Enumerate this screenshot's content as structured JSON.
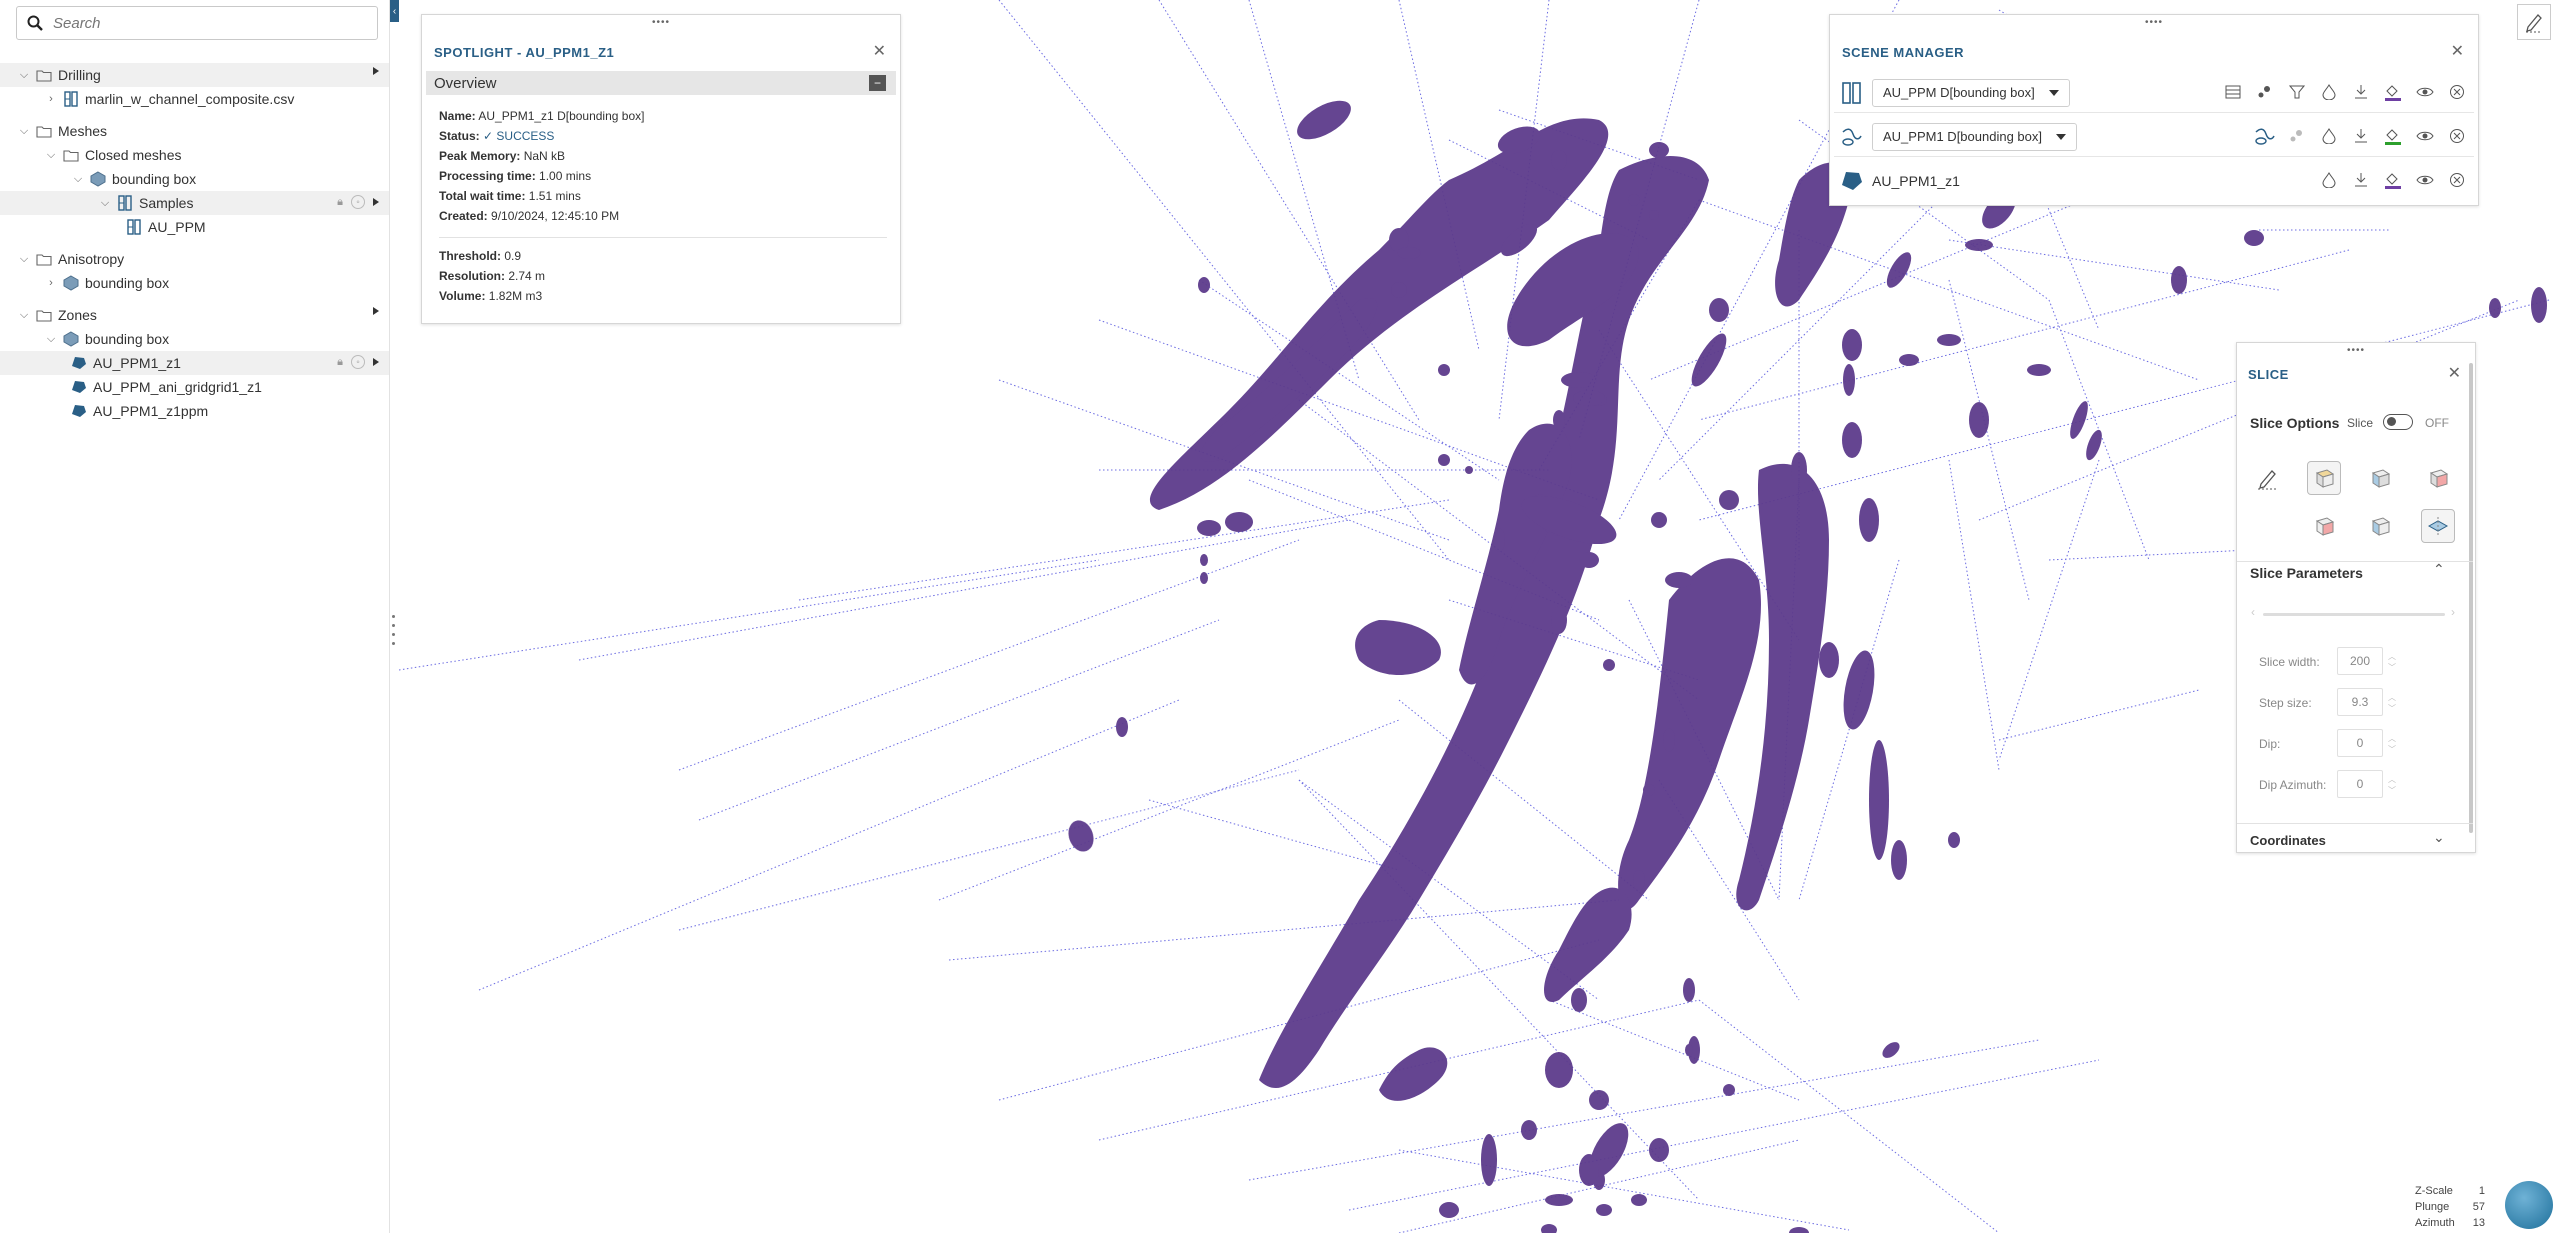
{
  "search": {
    "placeholder": "Search"
  },
  "tree": {
    "drilling": {
      "label": "Drilling",
      "children": [
        {
          "label": "marlin_w_channel_composite.csv"
        }
      ]
    },
    "meshes": {
      "label": "Meshes",
      "closed": "Closed meshes",
      "bbox": "bounding box",
      "samples": "Samples",
      "au_ppm": "AU_PPM"
    },
    "anisotropy": {
      "label": "Anisotropy",
      "bbox": "bounding box"
    },
    "zones": {
      "label": "Zones",
      "bbox": "bounding box",
      "items": [
        "AU_PPM1_z1",
        "AU_PPM_ani_gridgrid1_z1",
        "AU_PPM1_z1ppm"
      ]
    }
  },
  "spotlight": {
    "title": "SPOTLIGHT - AU_PPM1_Z1",
    "overview": "Overview",
    "fields": {
      "name_k": "Name:",
      "name_v": "AU_PPM1_z1 D[bounding box]",
      "status_k": "Status:",
      "status_v": "SUCCESS",
      "mem_k": "Peak Memory:",
      "mem_v": "NaN kB",
      "proc_k": "Processing time:",
      "proc_v": "1.00 mins",
      "wait_k": "Total wait time:",
      "wait_v": "1.51 mins",
      "created_k": "Created:",
      "created_v": "9/10/2024, 12:45:10 PM",
      "thr_k": "Threshold:",
      "thr_v": "0.9",
      "res_k": "Resolution:",
      "res_v": "2.74 m",
      "vol_k": "Volume:",
      "vol_v": "1.82M m3"
    }
  },
  "scene": {
    "title": "SCENE MANAGER",
    "rows": [
      "AU_PPM D[bounding box]",
      "AU_PPM1 D[bounding box]",
      "AU_PPM1_z1"
    ]
  },
  "slice": {
    "title": "SLICE",
    "options": "Slice Options",
    "slice_label": "Slice",
    "off": "OFF",
    "params": "Slice Parameters",
    "width_k": "Slice width:",
    "width_v": "200",
    "step_k": "Step size:",
    "step_v": "9.3",
    "dip_k": "Dip:",
    "dip_v": "0",
    "dipaz_k": "Dip Azimuth:",
    "dipaz_v": "0",
    "coords": "Coordinates"
  },
  "hud": {
    "zscale_k": "Z-Scale",
    "zscale_v": "1",
    "plunge_k": "Plunge",
    "plunge_v": "57",
    "azimuth_k": "Azimuth",
    "azimuth_v": "13"
  },
  "colors": {
    "accent": "#2a5f86",
    "mesh": "#5d3b8c",
    "drill": "#3a3ad8"
  }
}
